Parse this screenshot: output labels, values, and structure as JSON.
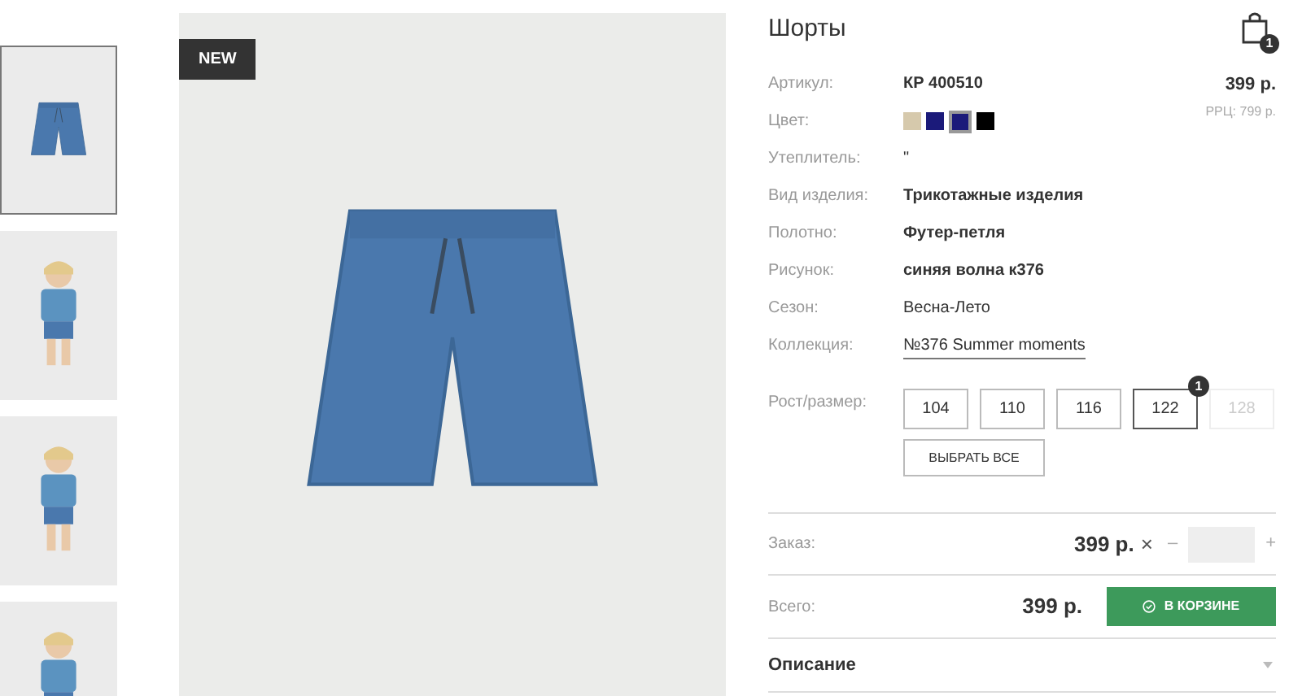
{
  "gallery": {
    "thumbnails": [
      {
        "kind": "product",
        "selected": true
      },
      {
        "kind": "model",
        "selected": false
      },
      {
        "kind": "model",
        "selected": false
      },
      {
        "kind": "model",
        "selected": false
      }
    ],
    "badge": "NEW"
  },
  "product": {
    "title": "Шорты",
    "cart_count": "1",
    "price": "399 р.",
    "rrp": "РРЦ: 799 р.",
    "attributes": [
      {
        "kind": "strong",
        "label": "Артикул:",
        "value": "КР 400510"
      },
      {
        "kind": "colors",
        "label": "Цвет:",
        "colors": [
          {
            "color": "#d6c9ac",
            "selected": false
          },
          {
            "color": "#1b1a7a",
            "selected": false
          },
          {
            "color": "#1b1a7a",
            "selected": true
          },
          {
            "color": "#000000",
            "selected": false
          }
        ]
      },
      {
        "kind": "text",
        "label": "Утеплитель:",
        "value": "\""
      },
      {
        "kind": "strong",
        "label": "Вид изделия:",
        "value": "Трикотажные изделия"
      },
      {
        "kind": "strong",
        "label": "Полотно:",
        "value": "Футер-петля"
      },
      {
        "kind": "strong",
        "label": "Рисунок:",
        "value": "синяя волна к376"
      },
      {
        "kind": "text",
        "label": "Сезон:",
        "value": "Весна-Лето"
      },
      {
        "kind": "link",
        "label": "Коллекция:",
        "value": "№376 Summer moments"
      }
    ],
    "sizes_label": "Рост/размер:",
    "sizes": [
      {
        "label": "104",
        "selected": false,
        "disabled": false
      },
      {
        "label": "110",
        "selected": false,
        "disabled": false
      },
      {
        "label": "116",
        "selected": false,
        "disabled": false
      },
      {
        "label": "122",
        "selected": true,
        "disabled": false,
        "count": "1"
      },
      {
        "label": "128",
        "selected": false,
        "disabled": true
      }
    ],
    "select_all": "ВЫБРАТЬ ВСЕ",
    "order": {
      "label": "Заказ:",
      "price": "399 р.",
      "times": "×",
      "minus": "–",
      "plus": "+"
    },
    "total": {
      "label": "Всего:",
      "price": "399 р.",
      "button": "В КОРЗИНЕ"
    },
    "description": {
      "label": "Описание",
      "expanded": false
    }
  }
}
